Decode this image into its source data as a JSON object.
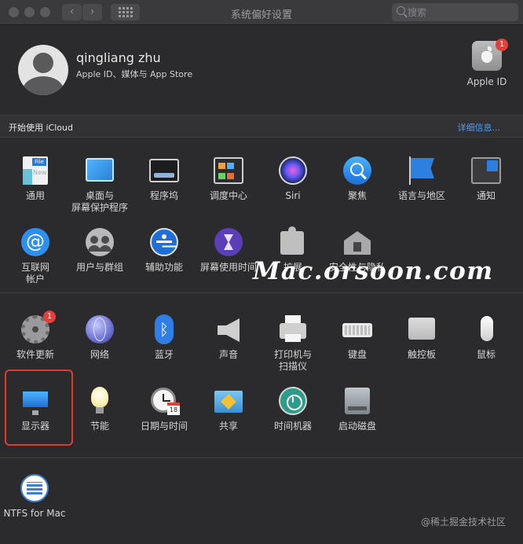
{
  "window": {
    "title": "系统偏好设置"
  },
  "toolbar": {
    "back": "‹",
    "forward": "›",
    "search_placeholder": "搜索"
  },
  "account": {
    "name": "qingliang zhu",
    "subtitle": "Apple ID、媒体与 App Store",
    "apple_id_label": "Apple ID",
    "apple_id_badge": "1"
  },
  "icloud": {
    "label": "开始使用 iCloud",
    "link": "详细信息..."
  },
  "row1": [
    "通用",
    "桌面与\n屏幕保护程序",
    "程序坞",
    "调度中心",
    "Siri",
    "聚焦",
    "语言与地区",
    "通知"
  ],
  "row2": [
    "互联网\n帐户",
    "用户与群组",
    "辅助功能",
    "屏幕使用时间",
    "扩展",
    "安全性与隐私"
  ],
  "row3": [
    "软件更新",
    "网络",
    "蓝牙",
    "声音",
    "打印机与\n扫描仪",
    "键盘",
    "触控板",
    "鼠标"
  ],
  "row3_badge": "1",
  "row4": [
    "显示器",
    "节能",
    "日期与时间",
    "共享",
    "时间机器",
    "启动磁盘"
  ],
  "row5": [
    "NTFS for Mac"
  ],
  "icons": {
    "file_tab": "File",
    "file_strip": "New",
    "calendar_day": "18",
    "at_glyph": "@",
    "bluetooth_glyph": "ᛒ"
  },
  "watermark": "Mac.orsoon.com",
  "footer_note": "@稀土掘金技术社区",
  "colors": {
    "accent": "#4c9dff",
    "badge": "#e2403a",
    "highlight": "#e53a32"
  }
}
